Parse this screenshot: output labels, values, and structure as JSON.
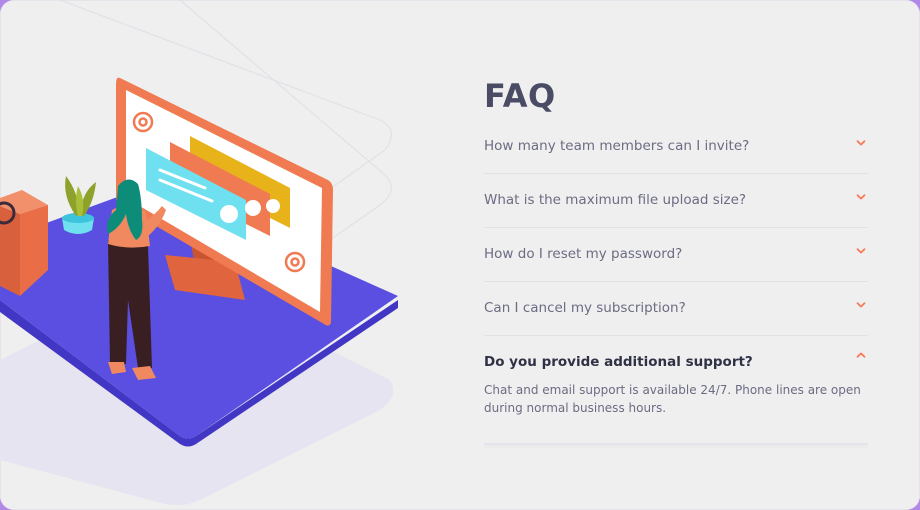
{
  "faq": {
    "title": "FAQ",
    "items": [
      {
        "question": "How many team members can I invite?",
        "open": false
      },
      {
        "question": "What is the maximum file upload size?",
        "open": false
      },
      {
        "question": "How do I reset my password?",
        "open": false
      },
      {
        "question": "Can I cancel my subscription?",
        "open": false
      },
      {
        "question": "Do you provide additional support?",
        "open": true,
        "answer": "Chat and email support is available 24/7. Phone lines are open during normal business hours."
      }
    ]
  },
  "colors": {
    "page_background": "#b187e8",
    "card_background": "#f0eff0",
    "title_text": "#4a4b65",
    "question_text": "#6b6c82",
    "active_question_text": "#2f3145",
    "chevron_accent": "#f47b56",
    "platform_purple": "#5a4fe0",
    "monitor_orange": "#f07a52",
    "chat_bubble_cyan": "#6ee0f0",
    "chat_bubble_yellow": "#e8b31a"
  },
  "icons": {
    "chevron_closed": "chevron-down-icon",
    "chevron_open": "chevron-up-icon",
    "at_sign": "at-sign-icon"
  }
}
